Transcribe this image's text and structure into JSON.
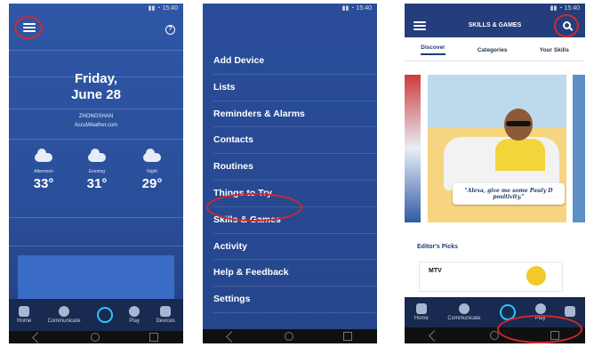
{
  "screen1": {
    "date_line1": "Friday,",
    "date_line2": "June 28",
    "location": "ZHONGSHAN",
    "source": "AccuWeather.com",
    "forecast": [
      {
        "label": "Afternoon",
        "temp": "33°",
        "icon": "cloudy-icon"
      },
      {
        "label": "Evening",
        "temp": "31°",
        "icon": "cloudy-icon"
      },
      {
        "label": "Night",
        "temp": "29°",
        "icon": "cloudy-night-icon"
      }
    ],
    "help_icon": "?",
    "tabs": [
      {
        "label": "Home",
        "icon": "home-icon"
      },
      {
        "label": "Communicate",
        "icon": "communicate-icon"
      },
      {
        "label": "",
        "icon": "alexa-icon"
      },
      {
        "label": "Play",
        "icon": "play-icon"
      },
      {
        "label": "Devices",
        "icon": "devices-icon"
      }
    ]
  },
  "screen2": {
    "menu": [
      "Add Device",
      "Lists",
      "Reminders & Alarms",
      "Contacts",
      "Routines",
      "Things to Try",
      "Skills & Games",
      "Activity",
      "Help & Feedback",
      "Settings"
    ]
  },
  "screen3": {
    "header_title": "SKILLS & GAMES",
    "tabs": [
      "Discover",
      "Categories",
      "Your Skills"
    ],
    "quote": "\"Alexa, give me some Pauly D positivity.\"",
    "section_title": "Editor's Picks",
    "card_title": "MTV",
    "tabs_bottom": [
      {
        "label": "Home",
        "icon": "home-icon"
      },
      {
        "label": "Communicate",
        "icon": "communicate-icon"
      },
      {
        "label": "",
        "icon": "alexa-icon"
      },
      {
        "label": "Play",
        "icon": "play-icon"
      },
      {
        "label": "",
        "icon": "devices-icon"
      }
    ]
  },
  "colors": {
    "accent_red": "#d6262b",
    "alexa_blue": "#2ec4ff",
    "primary_blue": "#2f57a6"
  }
}
